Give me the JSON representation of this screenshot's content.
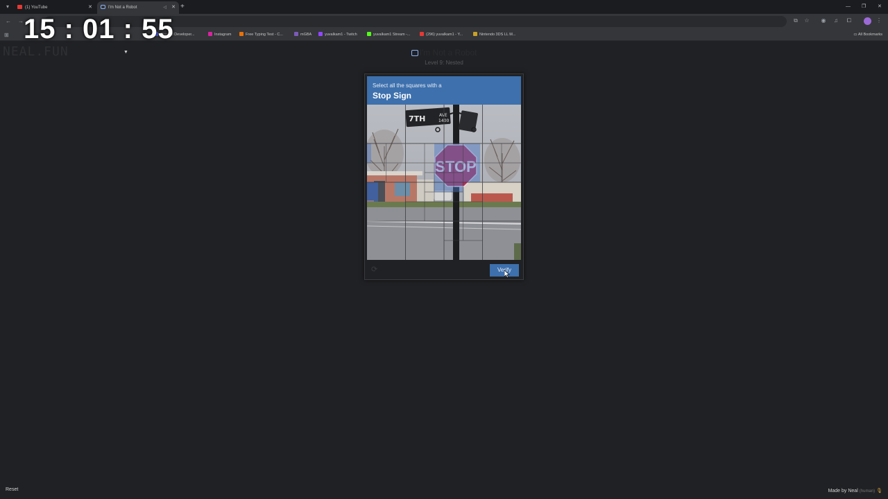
{
  "browser": {
    "tabs": [
      {
        "title": "(1) YouTube",
        "favicon": "youtube-icon",
        "active": false
      },
      {
        "title": "I'm Not a Robot",
        "favicon": "robot-icon",
        "active": true
      }
    ],
    "bookmarks": [
      {
        "label": "Discord Developer...",
        "color": "#5865f2"
      },
      {
        "label": "Instagram",
        "color": "#d6249f"
      },
      {
        "label": "Free Typing Test - C...",
        "color": "#e8710a"
      },
      {
        "label": "mGBA",
        "color": "#7b5bb6"
      },
      {
        "label": "yuvalkam1 - Twitch",
        "color": "#9146ff"
      },
      {
        "label": "yuvalkam1 Stream -...",
        "color": "#53fc18"
      },
      {
        "label": "(296) yuvalkam1 - Y...",
        "color": "#e53935"
      },
      {
        "label": "Nintendo 3DS LL M...",
        "color": "#c9a227"
      }
    ],
    "all_bookmarks_label": "All Bookmarks"
  },
  "overlay": {
    "clock": "15 : 01 : 55"
  },
  "page": {
    "logo": "NEAL.FUN",
    "title": "I'm Not a Robot",
    "subtitle": "Level 9: Nested"
  },
  "captcha": {
    "instruction": "Select all the squares with a",
    "target": "Stop Sign",
    "sign_text": "STOP",
    "street_sign_left": "7TH",
    "street_sign_right": "AVE",
    "street_sign_number": "1400",
    "verify_label": "Verify",
    "accent_color": "#3d70ad"
  },
  "footer": {
    "reset_label": "Reset",
    "made_by_label": "Made by Neal",
    "made_by_note": "(human)"
  }
}
